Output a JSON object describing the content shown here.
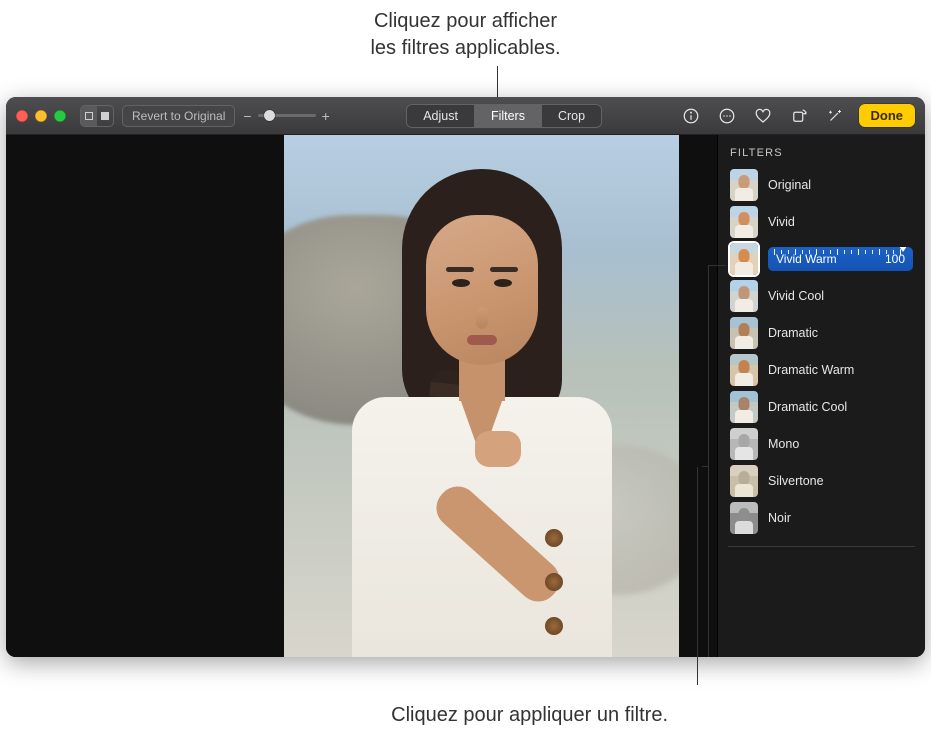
{
  "callouts": {
    "top_line1": "Cliquez pour afficher",
    "top_line2": "les filtres applicables.",
    "bottom": "Cliquez pour appliquer un filtre."
  },
  "toolbar": {
    "revert_label": "Revert to Original",
    "tabs": {
      "adjust": "Adjust",
      "filters": "Filters",
      "crop": "Crop"
    },
    "done_label": "Done"
  },
  "filters_panel": {
    "title": "FILTERS",
    "selected_index": 2,
    "selected_intensity": "100",
    "items": [
      {
        "label": "Original"
      },
      {
        "label": "Vivid"
      },
      {
        "label": "Vivid Warm"
      },
      {
        "label": "Vivid Cool"
      },
      {
        "label": "Dramatic"
      },
      {
        "label": "Dramatic Warm"
      },
      {
        "label": "Dramatic Cool"
      },
      {
        "label": "Mono"
      },
      {
        "label": "Silvertone"
      },
      {
        "label": "Noir"
      }
    ]
  }
}
